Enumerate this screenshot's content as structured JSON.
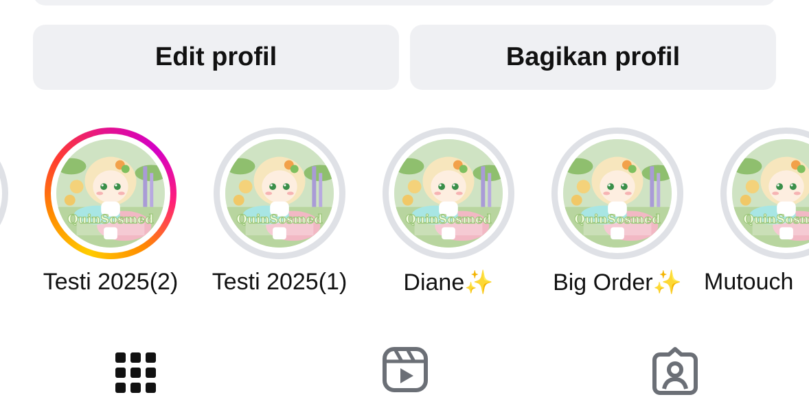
{
  "actions": {
    "edit_label": "Edit profil",
    "share_label": "Bagikan profil"
  },
  "highlights": [
    {
      "label": "Testi 2025(2)",
      "unseen": true
    },
    {
      "label": "Testi 2025(1)",
      "unseen": false
    },
    {
      "label": "Diane✨",
      "unseen": false
    },
    {
      "label": "Big Order✨",
      "unseen": false
    },
    {
      "label": "Mutouch",
      "unseen": false
    }
  ],
  "thumbnail_watermark": "QuinSosmed",
  "tabs": [
    {
      "icon": "grid-icon",
      "active": true
    },
    {
      "icon": "reels-icon",
      "active": false
    },
    {
      "icon": "tagged-icon",
      "active": false
    }
  ],
  "colors": {
    "button_bg": "#eff0f3",
    "ring_seen": "#dfe1e6",
    "text": "#111111",
    "icon_inactive": "#6b6f76"
  }
}
